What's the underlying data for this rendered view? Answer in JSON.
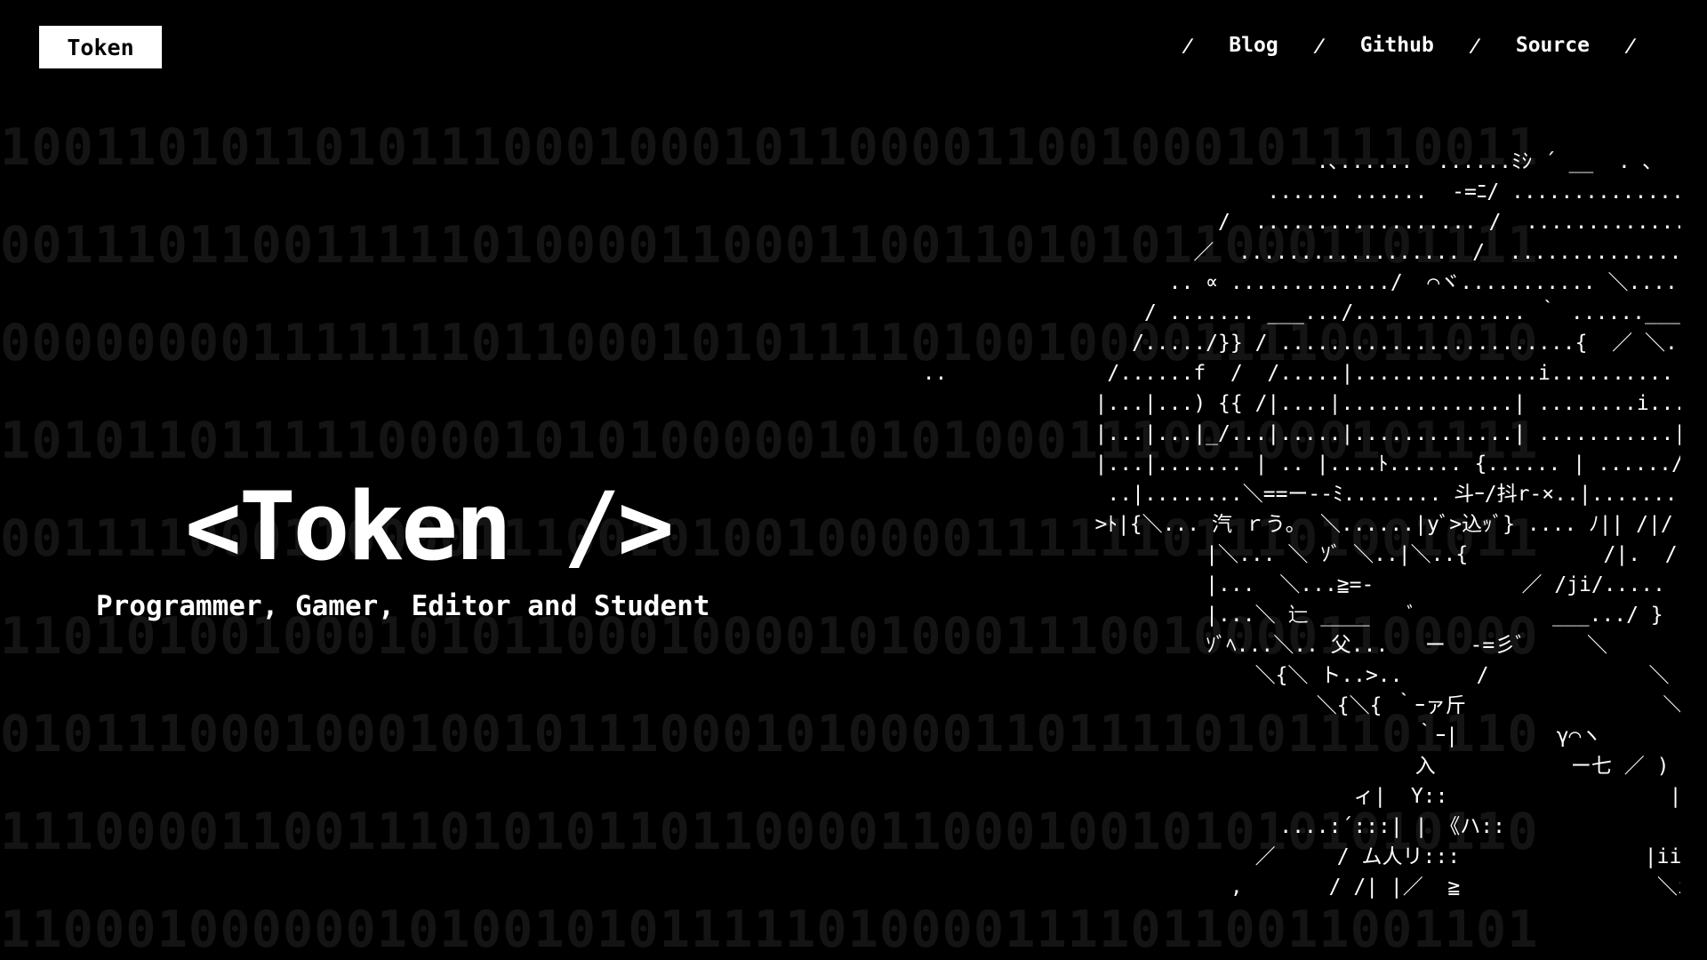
{
  "header": {
    "logo_label": "Token",
    "nav": {
      "separator": "/",
      "items": [
        {
          "label": "Blog"
        },
        {
          "label": "Github"
        },
        {
          "label": "Source"
        }
      ]
    }
  },
  "hero": {
    "title": "<Token />",
    "subtitle": "Programmer, Gamer, Editor and Student"
  },
  "background": {
    "binary_rows": [
      "1001101011010111000100010110000110010001011110011",
      "0011101100111110100001100011001101010110001101111",
      "0000000011111110110001010111101001000011110011010",
      "1010110111110000101010000010101000111001000101111",
      "0011110001100001110010100100000111111011101001011",
      "1101010010001010110001000010100011100100001100000",
      "0101110001000100101110001010000110111101011101110",
      "1110000110011101010110110000110001001010101010110",
      "1100010000001010010101111101000011110110011001101"
    ]
  },
  "ascii_art": {
    "text": "                                  .､......  ......ﾐｼ ´ __  . ､\n                              ...... ......  -=ﾆ/ ...................  ＼\n                          /  .................. /  ....................... ＼\n                        ／  .................. /  ........................ ＼\n                      .. ∝ ............./  ⌒ヾ........... ＼........... ＼. ハ\n                    / ....... ___.../.............. ｀ ......_____ ..........＼...\n                   /...../}} / ........................{  ／ ＼.... ＼.....\n  ..             /......f  /  /.....|...............i..........  ＼  ＼.. i...)ﾊ ﾉ\\\n                |...|...) {{ /|....|..............| ........i.....＼|| {} | |.........\\ ,.)\n                |...|...|_/...|.....|.............| ...........|.../|... ー- | ﾄ.....V\n                |...|....... | .. |....ﾄ...... {...... | ....../|./  ___...|.....| |  /\\...}\n                 ..|........＼==ー--ﾐ........ 斗ｰ/抖r-×..|.......|......V\n                >ﾄ|{＼... 汽 ｒう｡  ＼......|yﾞ>込ｯﾞ} .... ﾉ|| /|/\n                         |＼... ＼ ｿﾞ ＼..|＼..{           /|.  /.../..\n                         |...  ＼...≧=-            ／ /ji/.....\n                         |...＼ 辷 ____   ﾞ           ___.../ }\n                         ｿﾞﾍ...＼.. 父...   ー  -=彡ﾞ     ＼\n                             ＼{＼ ト..>..      /             ＼\n                                  ＼{＼{ ｀ｰァ斤                ＼\n                                          ｀ｰ|        γ⌒ヽ       ｙ ＼\n                                          入           ー七 ／ )      ﾄ, ＼\n                                     ィ|  Y::                  |iiiﾞ ___ j\n                               ....:´:::| | 《ハ::                 |iiiiiハ ¯¯,\n                             ／     / ム人リ:::               |iiiiiⅥ ∩ |\n                           ,       / /| |／  ≧                ＼iiⅦ | |"
  }
}
